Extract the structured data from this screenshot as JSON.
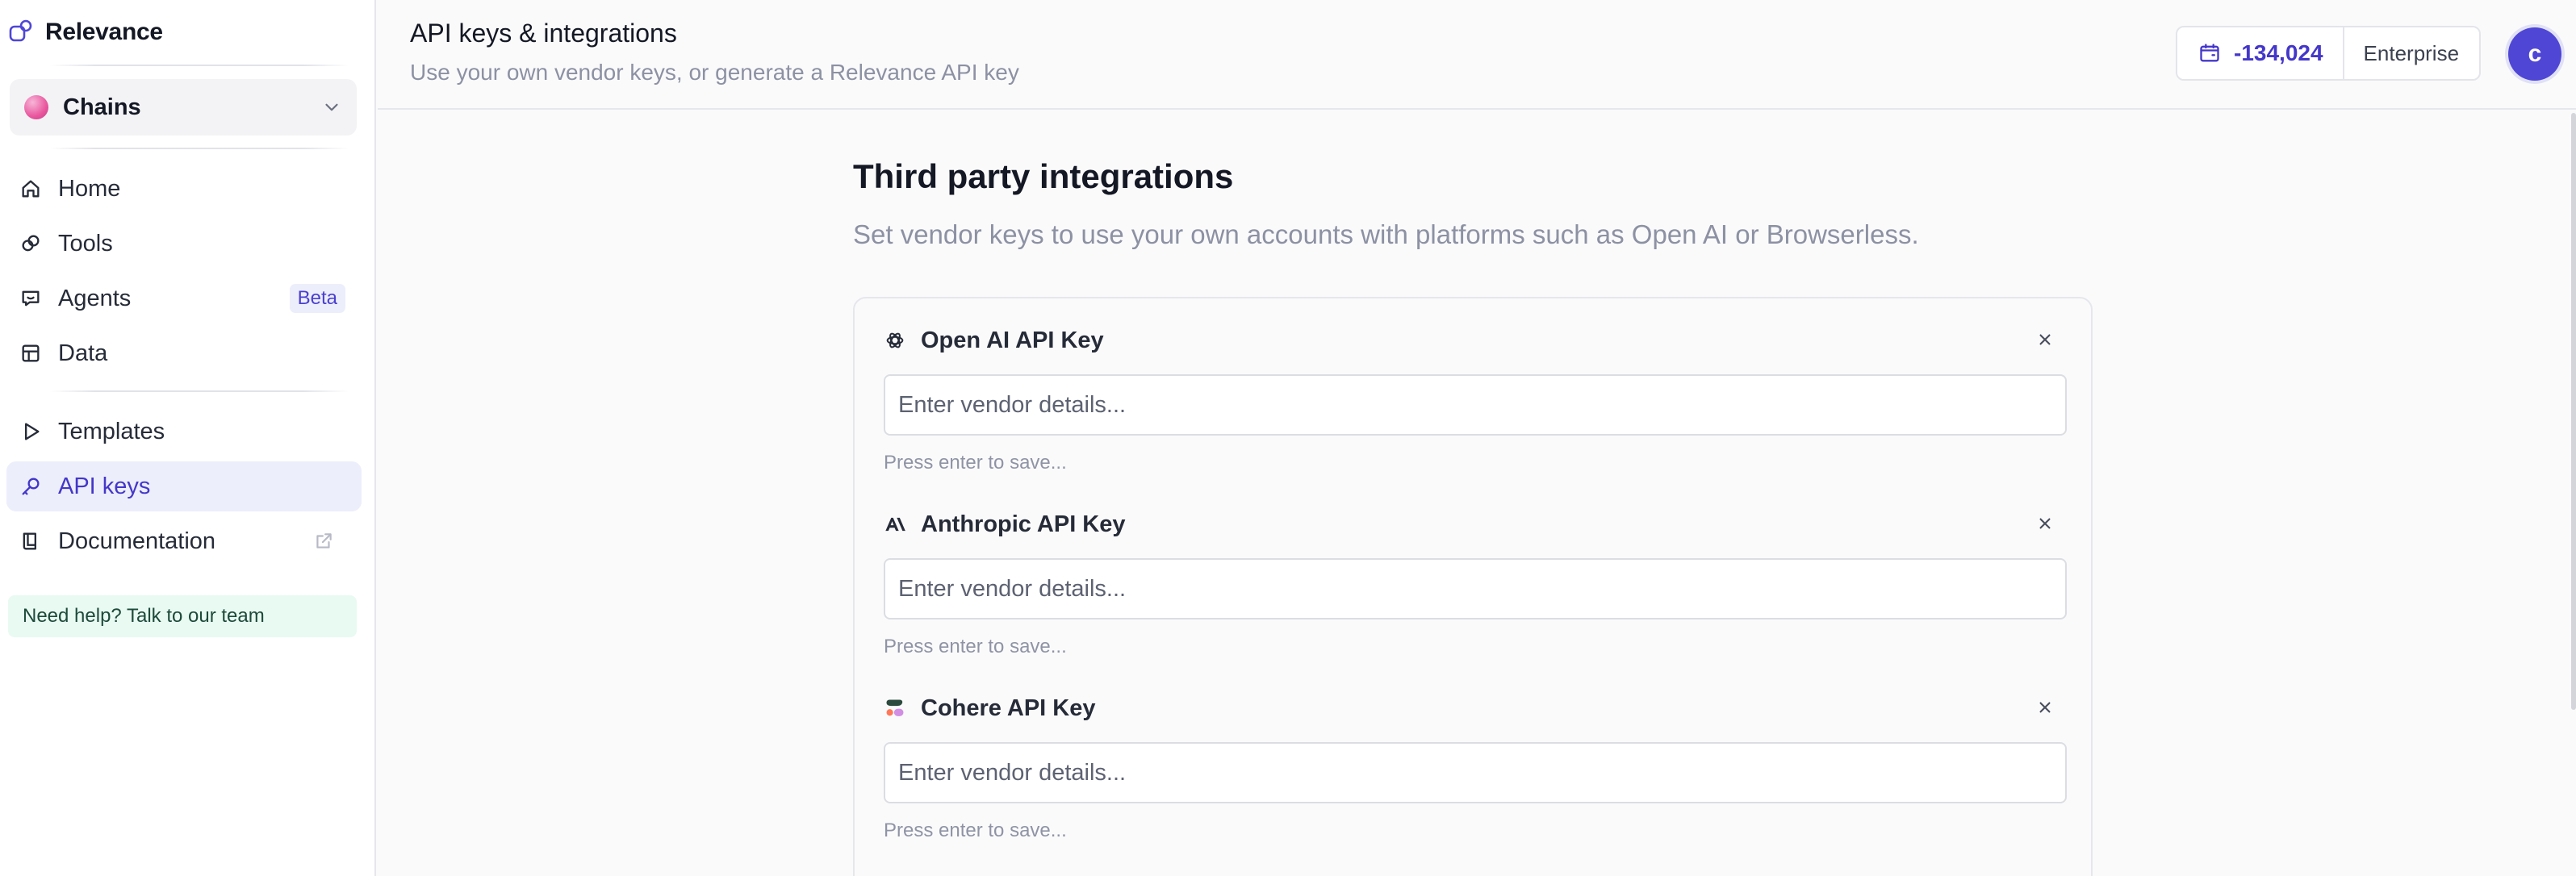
{
  "brand": {
    "name": "Relevance"
  },
  "workspace": {
    "name": "Chains"
  },
  "nav": [
    {
      "label": "Home",
      "icon": "home-icon"
    },
    {
      "label": "Tools",
      "icon": "tools-icon"
    },
    {
      "label": "Agents",
      "icon": "agents-icon",
      "badge": "Beta"
    },
    {
      "label": "Data",
      "icon": "data-table-icon"
    },
    {
      "label": "Templates",
      "icon": "play-icon"
    },
    {
      "label": "API keys",
      "icon": "key-icon",
      "active": true
    },
    {
      "label": "Documentation",
      "icon": "book-icon",
      "external": true
    }
  ],
  "help": {
    "label": "Need help? Talk to our team"
  },
  "header": {
    "title": "API keys & integrations",
    "subtitle": "Use your own vendor keys, or generate a Relevance API key",
    "credits": "-134,024",
    "plan": "Enterprise",
    "avatar_initial": "c"
  },
  "integrations": {
    "title": "Third party integrations",
    "subtitle": "Set vendor keys to use your own accounts with platforms such as Open AI or Browserless.",
    "vendors": [
      {
        "title": "Open AI API Key",
        "icon": "openai-icon",
        "placeholder": "Enter vendor details...",
        "hint": "Press enter to save..."
      },
      {
        "title": "Anthropic API Key",
        "icon": "anthropic-icon",
        "placeholder": "Enter vendor details...",
        "hint": "Press enter to save..."
      },
      {
        "title": "Cohere API Key",
        "icon": "cohere-icon",
        "placeholder": "Enter vendor details...",
        "hint": "Press enter to save..."
      }
    ]
  },
  "colors": {
    "accent": "#4437c9",
    "avatar": "#4f46d6",
    "help_bg": "#e9faf3",
    "active_nav_bg": "#eceefb"
  }
}
